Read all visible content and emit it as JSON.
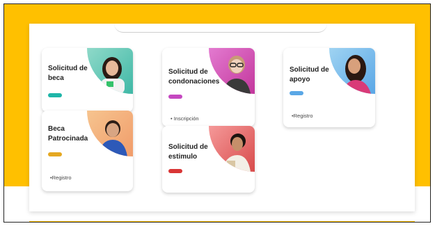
{
  "cards": [
    {
      "title": "Solicitud de beca",
      "accent": "#1FB5A8",
      "links": []
    },
    {
      "title": "Beca Patrocinada",
      "accent": "#E5A821",
      "links": [
        "•Registro"
      ]
    },
    {
      "title": "Solicitud de condonaciones",
      "accent": "#C548C1",
      "links": [
        "• Inscripción"
      ]
    },
    {
      "title": "Solicitud de estimulo",
      "accent": "#D93636",
      "links": []
    },
    {
      "title": "Solicitud de apoyo",
      "accent": "#5AA7E6",
      "links": [
        "•Registro"
      ]
    }
  ],
  "colors": {
    "brand_yellow": "#FFC000"
  }
}
